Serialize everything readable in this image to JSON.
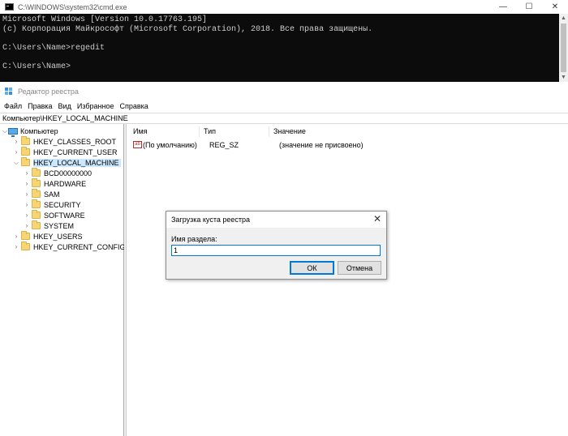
{
  "cmd": {
    "title": "C:\\WINDOWS\\system32\\cmd.exe",
    "lines": [
      "Microsoft Windows [Version 10.0.17763.195]",
      "(c) Корпорация Майкрософт (Microsoft Corporation), 2018. Все права защищены.",
      "",
      "C:\\Users\\Name>regedit",
      "",
      "C:\\Users\\Name>"
    ],
    "controls": {
      "minimize": "—",
      "maximize": "☐",
      "close": "✕"
    }
  },
  "regedit": {
    "title": "Редактор реестра",
    "menu": [
      "Файл",
      "Правка",
      "Вид",
      "Избранное",
      "Справка"
    ],
    "address": "Компьютер\\HKEY_LOCAL_MACHINE",
    "tree": {
      "root": "Компьютер",
      "hives": [
        "HKEY_CLASSES_ROOT",
        "HKEY_CURRENT_USER",
        "HKEY_LOCAL_MACHINE"
      ],
      "hklm_children": [
        "BCD00000000",
        "HARDWARE",
        "SAM",
        "SECURITY",
        "SOFTWARE",
        "SYSTEM"
      ],
      "hives_after": [
        "HKEY_USERS",
        "HKEY_CURRENT_CONFIG"
      ]
    },
    "columns": {
      "name": "Имя",
      "type": "Тип",
      "value": "Значение"
    },
    "values": [
      {
        "name": "(По умолчанию)",
        "type": "REG_SZ",
        "data": "(значение не присвоено)",
        "icon": "ab"
      }
    ]
  },
  "dialog": {
    "title": "Загрузка куста реестра",
    "label": "Имя раздела:",
    "input_value": "1",
    "ok_label": "ОК",
    "cancel_label": "Отмена",
    "close": "✕"
  },
  "colors": {
    "console_bg": "#0c0c0c",
    "console_text": "#cccccc",
    "folder": "#f7d575",
    "selection": "#cce8ff",
    "accent": "#0078d7"
  }
}
